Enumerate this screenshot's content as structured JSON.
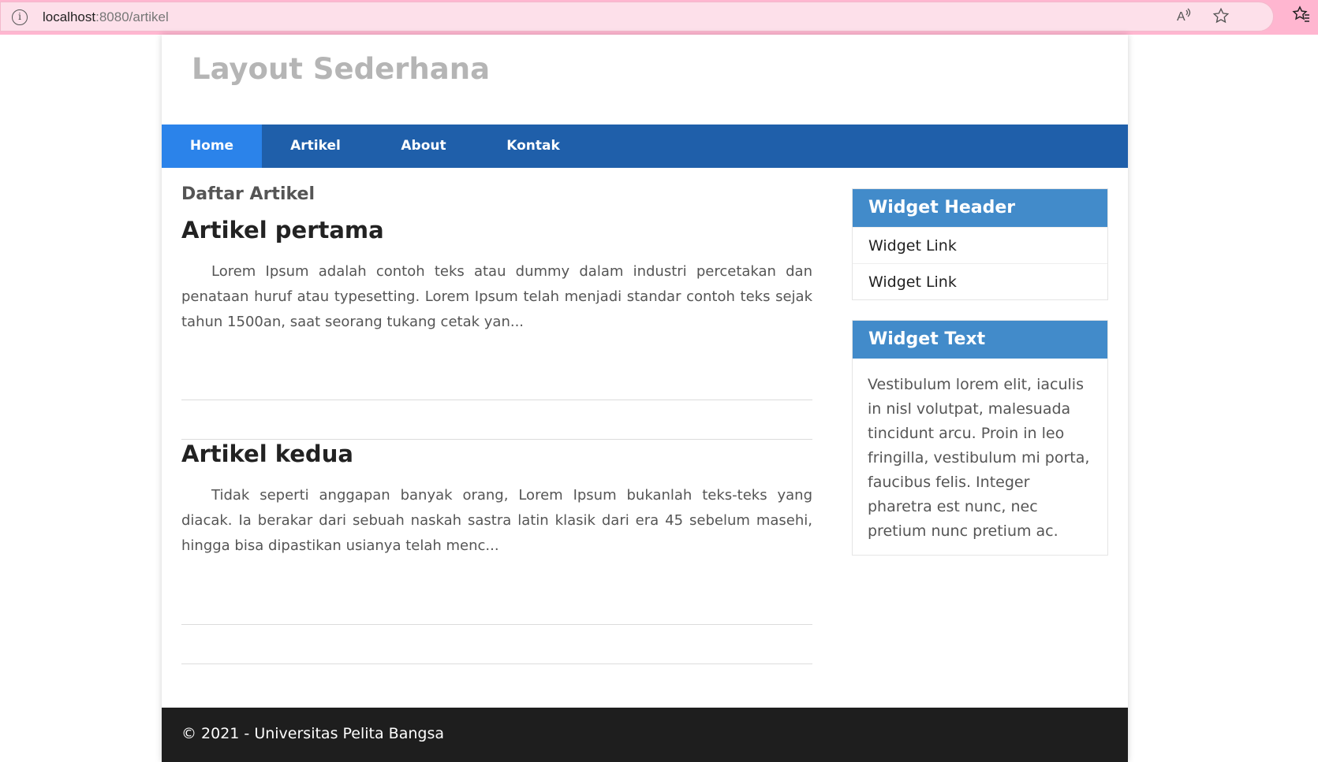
{
  "browser": {
    "url_host": "localhost",
    "url_path": ":8080/artikel",
    "read_aloud_icon": "read-aloud-icon",
    "favorite_icon": "star-icon",
    "favorites_icon": "favorites-icon"
  },
  "site": {
    "title": "Layout Sederhana"
  },
  "nav": {
    "items": [
      {
        "label": "Home",
        "active": true
      },
      {
        "label": "Artikel",
        "active": false
      },
      {
        "label": "About",
        "active": false
      },
      {
        "label": "Kontak",
        "active": false
      }
    ]
  },
  "main": {
    "heading": "Daftar Artikel",
    "articles": [
      {
        "title": "Artikel pertama",
        "excerpt": "Lorem Ipsum adalah contoh teks atau dummy dalam industri percetakan dan penataan huruf atau typesetting. Lorem Ipsum telah menjadi standar contoh teks sejak tahun 1500an, saat seorang tukang cetak yan..."
      },
      {
        "title": "Artikel kedua",
        "excerpt": "Tidak seperti anggapan banyak orang, Lorem Ipsum bukanlah teks-teks yang diacak. Ia berakar dari sebuah naskah sastra latin klasik dari era 45 sebelum masehi, hingga bisa dipastikan usianya telah menc..."
      }
    ]
  },
  "sidebar": {
    "widget1": {
      "header": "Widget Header",
      "links": [
        "Widget Link",
        "Widget Link"
      ]
    },
    "widget2": {
      "header": "Widget Text",
      "text": "Vestibulum lorem elit, iaculis in nisl volutpat, malesuada tincidunt arcu. Proin in leo fringilla, vestibulum mi porta, faucibus felis. Integer pharetra est nunc, nec pretium nunc pretium ac."
    }
  },
  "footer": {
    "text": "© 2021 - Universitas Pelita Bangsa"
  },
  "colors": {
    "nav_bg": "#1f5faa",
    "nav_active": "#2b83ea",
    "widget_header": "#428bca",
    "footer_bg": "#1e1e1e",
    "title_gray": "#b5b5b5"
  }
}
